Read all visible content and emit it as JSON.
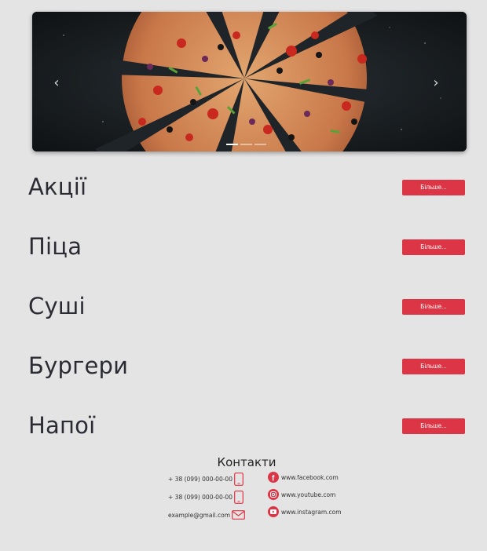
{
  "carousel": {
    "prev_label": "‹",
    "next_label": "›",
    "slides": 3,
    "active_slide": 1
  },
  "categories": [
    {
      "title": "Акції",
      "button": "Більше..."
    },
    {
      "title": "Піца",
      "button": "Більше..."
    },
    {
      "title": "Суші",
      "button": "Більше..."
    },
    {
      "title": "Бургери",
      "button": "Більше..."
    },
    {
      "title": "Напої",
      "button": "Більше..."
    }
  ],
  "contacts": {
    "title": "Контакти",
    "phone1": "+ 38 (099) 000-00-00",
    "phone2": "+ 38 (099) 000-00-00",
    "email": "example@gmail.com",
    "facebook": "www.facebook.com",
    "youtube": "www.youtube.com",
    "instagram": "www.instagram.com"
  },
  "colors": {
    "accent": "#dc3545",
    "background": "#e5e4e4",
    "heading": "#2b2b33"
  }
}
